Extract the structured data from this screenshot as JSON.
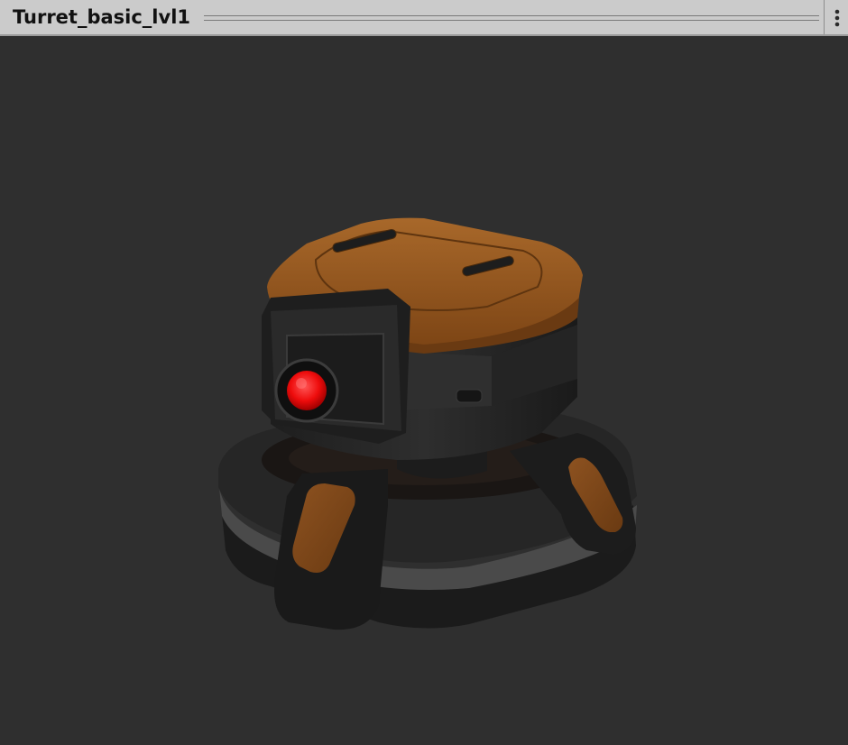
{
  "window": {
    "title": "Turret_basic_lvl1"
  },
  "titlebar": {
    "more_icon": "vertical-ellipsis-icon"
  },
  "viewport": {
    "background": "#2f2f2f",
    "model": "turret",
    "colors": {
      "top_plate": "#9a5a1c",
      "body": "#252525",
      "lens": "#ff1a1a",
      "accent_pads": "#7a4518"
    }
  }
}
